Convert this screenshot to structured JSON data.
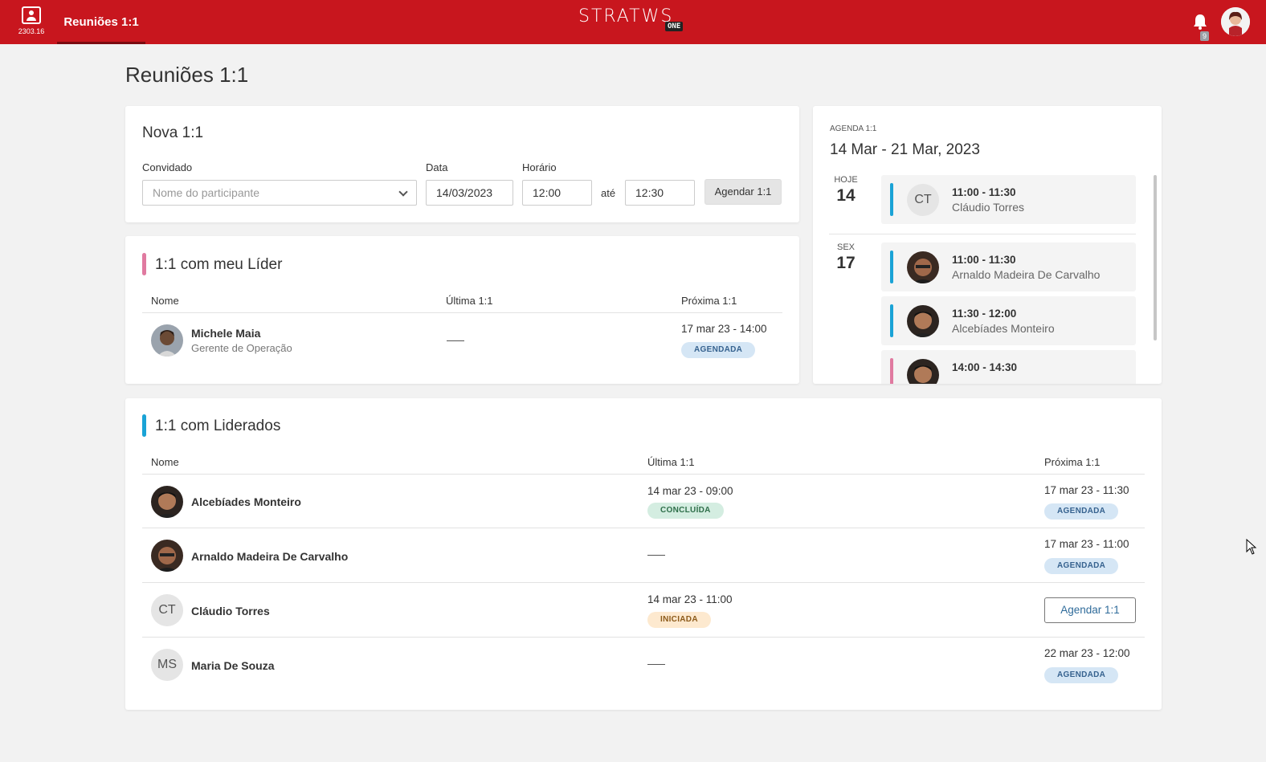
{
  "topbar": {
    "app_code": "2303.16",
    "tab_label": "Reuniões 1:1",
    "logo_text": "STRATWS",
    "logo_badge": "ONE",
    "notification_count": "9",
    "brand_color": "#c8161e"
  },
  "page": {
    "title": "Reuniões 1:1"
  },
  "nova": {
    "title": "Nova 1:1",
    "convidado_label": "Convidado",
    "convidado_placeholder": "Nome do participante",
    "data_label": "Data",
    "data_value": "14/03/2023",
    "horario_label": "Horário",
    "hora_inicio": "12:00",
    "ate": "até",
    "hora_fim": "12:30",
    "button": "Agendar 1:1"
  },
  "lider": {
    "title": "1:1 com meu Líder",
    "accent": "#e07aa0",
    "col_nome": "Nome",
    "col_ultima": "Última 1:1",
    "col_proxima": "Próxima 1:1",
    "rows": [
      {
        "name": "Michele Maia",
        "role": "Gerente de Operação",
        "proxima": "17 mar 23 - 14:00",
        "status": "AGENDADA"
      }
    ]
  },
  "agenda": {
    "small_label": "AGENDA 1:1",
    "range": "14 Mar - 21 Mar, 2023",
    "days": [
      {
        "name": "HOJE",
        "num": "14"
      },
      {
        "name": "SEX",
        "num": "17"
      }
    ],
    "events": [
      {
        "time": "11:00 - 11:30",
        "name": "Cláudio Torres",
        "initials": "CT",
        "color": "#1aa3d6"
      },
      {
        "time": "11:00 - 11:30",
        "name": "Arnaldo Madeira De Carvalho",
        "color": "#1aa3d6"
      },
      {
        "time": "11:30 - 12:00",
        "name": "Alcebíades Monteiro",
        "color": "#1aa3d6"
      },
      {
        "time": "14:00 - 14:30",
        "color": "#e07aa0"
      }
    ]
  },
  "liderados": {
    "title": "1:1 com Liderados",
    "accent": "#1aa3d6",
    "col_nome": "Nome",
    "col_ultima": "Última 1:1",
    "col_proxima": "Próxima 1:1",
    "rows": [
      {
        "name": "Alcebíades Monteiro",
        "ultima": "14 mar 23 - 09:00",
        "ultima_status": "CONCLUÍDA",
        "proxima": "17 mar 23 - 11:30",
        "proxima_status": "AGENDADA"
      },
      {
        "name": "Arnaldo Madeira De Carvalho",
        "proxima": "17 mar 23 - 11:00",
        "proxima_status": "AGENDADA"
      },
      {
        "name": "Cláudio Torres",
        "initials": "CT",
        "ultima": "14 mar 23 - 11:00",
        "ultima_status": "INICIADA",
        "action": "Agendar 1:1"
      },
      {
        "name": "Maria De Souza",
        "initials": "MS",
        "proxima": "22 mar 23 - 12:00",
        "proxima_status": "AGENDADA"
      }
    ]
  }
}
